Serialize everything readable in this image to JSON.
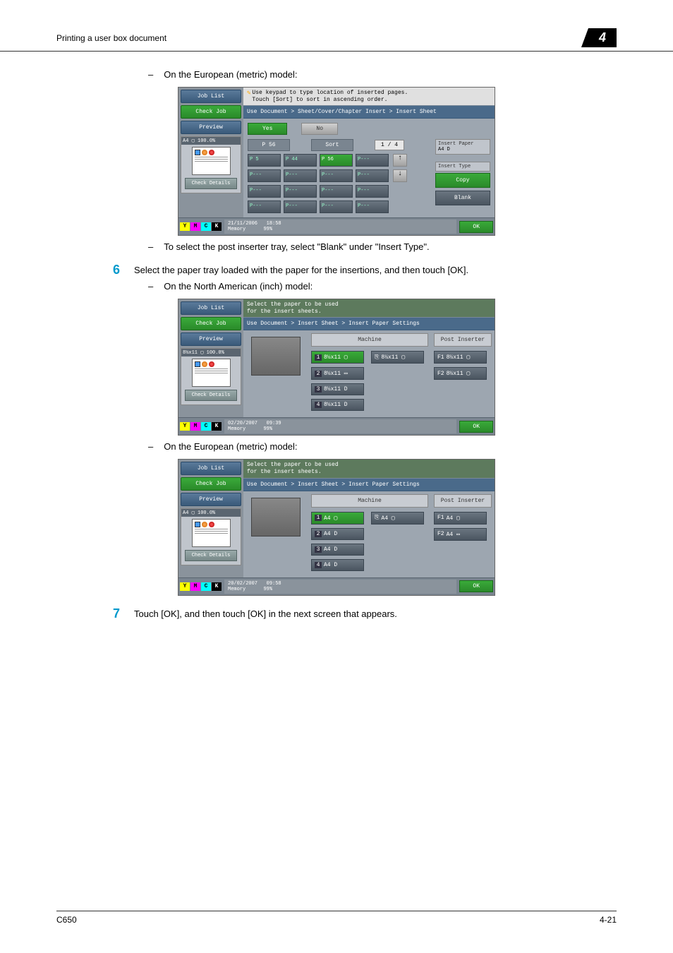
{
  "header": {
    "title": "Printing a user box document",
    "chapter": "4"
  },
  "text": {
    "euro_model": "On the European (metric) model:",
    "na_model": "On the North American (inch) model:",
    "post_inserter_note": "To select the post inserter tray, select \"Blank\" under \"Insert Type\".",
    "step6": "Select the paper tray loaded with the paper for the insertions, and then touch [OK].",
    "step7": "Touch [OK], and then touch [OK] in the next screen that appears."
  },
  "steps": {
    "s6": "6",
    "s7": "7"
  },
  "panel1": {
    "nav": {
      "job_list": "Job List",
      "check_job": "Check Job",
      "preview": "Preview",
      "check_details": "Check Details"
    },
    "thumb_label": "A4 ▢  100.0%",
    "msg": "Use keypad to type location of inserted pages.\nTouch [Sort] to sort in ascending order.",
    "breadcrumb": "Use Document > Sheet/Cover/Chapter Insert > Insert Sheet",
    "yes": "Yes",
    "no": "No",
    "p_label": "P 56",
    "sort": "Sort",
    "counter": "1 / 4",
    "pages": [
      "P  5",
      "P 44",
      "P 56",
      "P---",
      "P---",
      "P---",
      "P---",
      "P---",
      "P---",
      "P---",
      "P---",
      "P---",
      "P---",
      "P---",
      "P---",
      "P---"
    ],
    "insert_paper": "Insert Paper",
    "insert_paper_val": "A4 D",
    "insert_type": "Insert Type",
    "copy": "Copy",
    "blank": "Blank",
    "date": "21/11/2006",
    "time": "18:58",
    "mem": "Memory",
    "mem_val": "99%",
    "ok": "OK"
  },
  "panel2": {
    "thumb_label": "8½x11 ▢  100.0%",
    "msg": "Select the paper to be used\nfor the insert sheets.",
    "breadcrumb": "Use Document > Insert Sheet > Insert Paper Settings",
    "machine": "Machine",
    "post_inserter": "Post Inserter",
    "trays_m1": [
      "8½x11 ▢",
      "8½x11 ▭",
      "8½x11 D",
      "8½x11 D"
    ],
    "manual": "8½x11 ▢",
    "trays_pi": [
      "8½x11 ▢",
      "8½x11 ▢"
    ],
    "date": "02/20/2007",
    "time": "09:39",
    "ok": "OK"
  },
  "panel3": {
    "thumb_label": "A4 ▢  100.0%",
    "msg": "Select the paper to be used\nfor the insert sheets.",
    "breadcrumb": "Use Document > Insert Sheet > Insert Paper Settings",
    "machine": "Machine",
    "post_inserter": "Post Inserter",
    "trays_m1": [
      "A4 ▢",
      "A4 D",
      "A4 D",
      "A4 D"
    ],
    "manual": "A4 ▢",
    "trays_pi": [
      "A4 ▢",
      "A4 ▭"
    ],
    "date": "20/02/2007",
    "time": "09:58",
    "ok": "OK"
  },
  "footer": {
    "model": "C650",
    "page": "4-21"
  },
  "common": {
    "memory": "Memory",
    "mem_val": "99%"
  }
}
